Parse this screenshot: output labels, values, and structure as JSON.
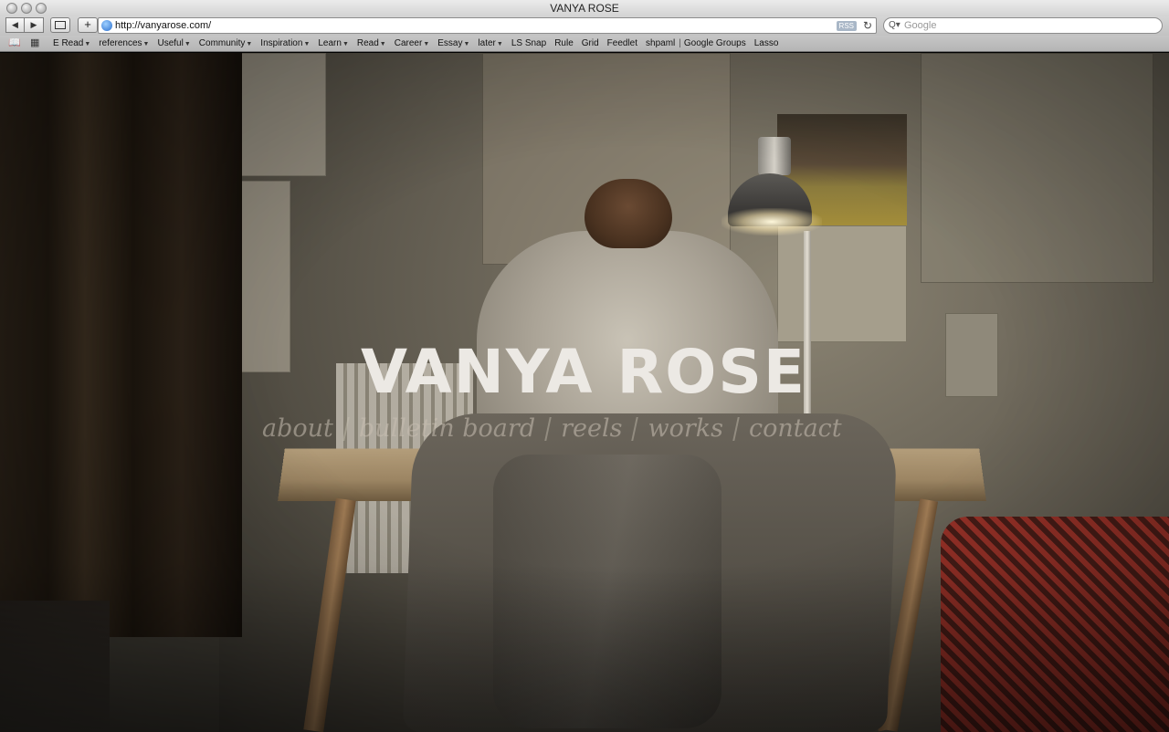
{
  "window": {
    "title": "VANYA ROSE"
  },
  "toolbar": {
    "back_glyph": "◀",
    "forward_glyph": "▶",
    "add_glyph": "+",
    "url": "http://vanyarose.com/",
    "rss_label": "RSS",
    "reload_glyph": "↻",
    "search_placeholder": "Google",
    "search_icon": "Q▾"
  },
  "bookmarks": {
    "book_icon": "📖",
    "grid_icon": "▦",
    "items": [
      {
        "label": "E Read",
        "menu": true
      },
      {
        "label": "references",
        "menu": true
      },
      {
        "label": "Useful",
        "menu": true
      },
      {
        "label": "Community",
        "menu": true
      },
      {
        "label": "Inspiration",
        "menu": true
      },
      {
        "label": "Learn",
        "menu": true
      },
      {
        "label": "Read",
        "menu": true
      },
      {
        "label": "Career",
        "menu": true
      },
      {
        "label": "Essay",
        "menu": true
      },
      {
        "label": "later",
        "menu": true
      },
      {
        "label": "LS Snap",
        "menu": false
      },
      {
        "label": "Rule",
        "menu": false
      },
      {
        "label": "Grid",
        "menu": false
      },
      {
        "label": "Feedlet",
        "menu": false
      },
      {
        "label": "shpaml",
        "menu": false
      },
      {
        "label": "Google Groups",
        "menu": false
      },
      {
        "label": "Lasso",
        "menu": false
      }
    ],
    "separator": "|"
  },
  "site": {
    "title": "VANYA ROSE",
    "nav": [
      "about",
      "bulletin board",
      "reels",
      "works",
      "contact"
    ]
  },
  "colors": {
    "title_text": "#ece9e4",
    "nav_text": "#c8c0b2"
  }
}
